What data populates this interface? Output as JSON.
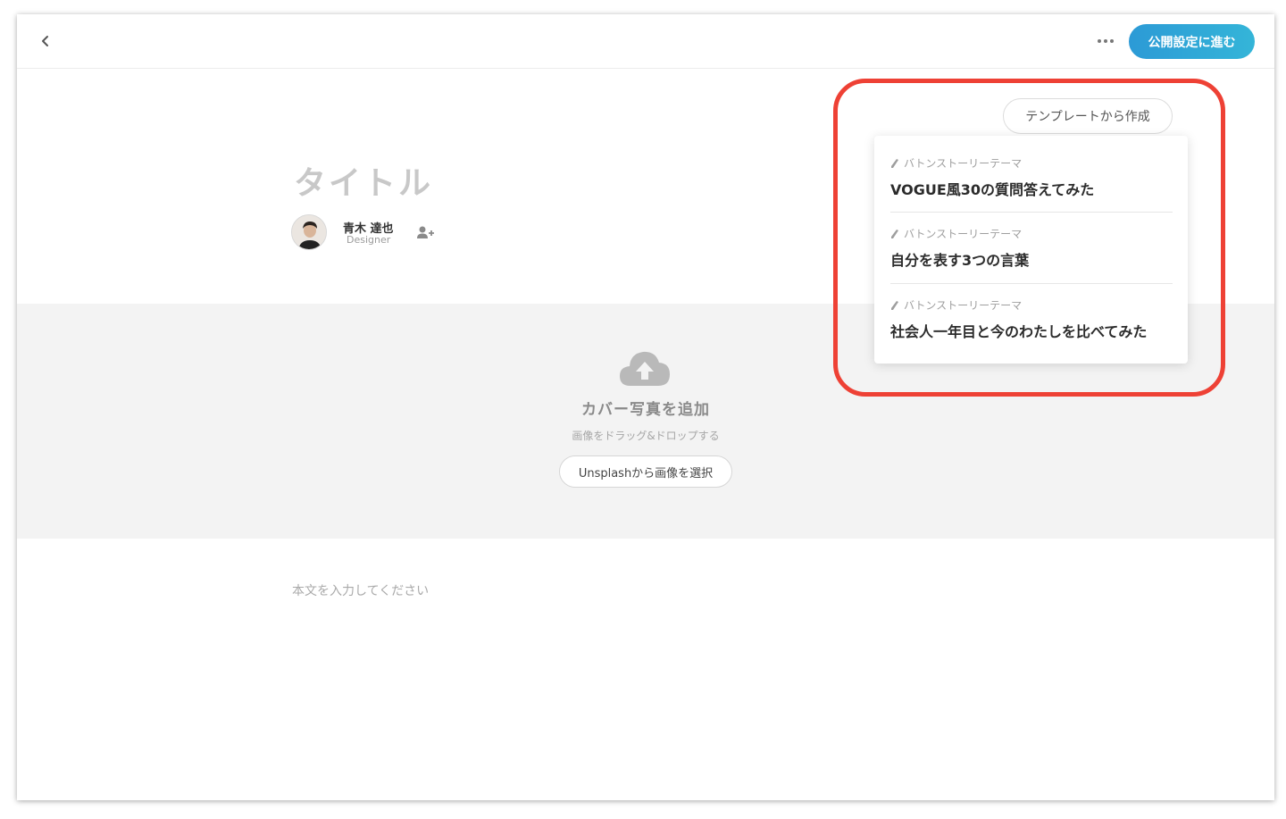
{
  "header": {
    "publish_label": "公開設定に進む"
  },
  "article": {
    "title_placeholder": "タイトル",
    "author_name": "青木 達也",
    "author_role": "Designer",
    "body_placeholder": "本文を入力してください"
  },
  "cover": {
    "title": "カバー写真を追加",
    "subtitle": "画像をドラッグ&ドロップする",
    "unsplash_label": "Unsplashから画像を選択"
  },
  "templates": {
    "button_label": "テンプレートから作成",
    "items": [
      {
        "category": "バトンストーリーテーマ",
        "title": "VOGUE風30の質問答えてみた"
      },
      {
        "category": "バトンストーリーテーマ",
        "title": "自分を表す3つの言葉"
      },
      {
        "category": "バトンストーリーテーマ",
        "title": "社会人一年目と今のわたしを比べてみた"
      }
    ]
  },
  "colors": {
    "publish_gradient_start": "#2c9ad6",
    "publish_gradient_end": "#34b5d8",
    "highlight": "#ee4135",
    "cover_background": "#f3f3f3"
  }
}
